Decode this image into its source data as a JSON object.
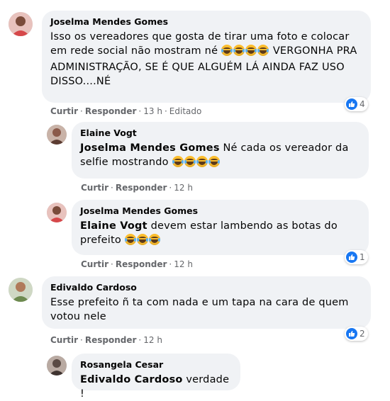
{
  "comments": [
    {
      "author": "Joselma Mendes Gomes",
      "text_before": "Isso os vereadores que gosta de tirar uma foto e colocar em rede social não mostram né",
      "emoji_count": 4,
      "text_after": "VERGONHA PRA ADMINISTRAÇÃO, SE É QUE ALGUÉM LÁ AINDA FAZ USO DISSO....NÉ",
      "like_label": "Curtir",
      "reply_label": "Responder",
      "time": "13 h",
      "edited": "Editado",
      "reaction_count": "4",
      "avatar_color": "#d6484a"
    },
    {
      "author": "Elaine Vogt",
      "mention": "Joselma Mendes Gomes",
      "text_before": "Né cada os vereador da selfie mostrando",
      "emoji_count": 4,
      "like_label": "Curtir",
      "reply_label": "Responder",
      "time": "12 h",
      "avatar_color": "#8a5a4a"
    },
    {
      "author": "Joselma Mendes Gomes",
      "mention": "Elaine Vogt",
      "text_before": "devem estar lambendo as botas do prefeito",
      "emoji_count": 3,
      "like_label": "Curtir",
      "reply_label": "Responder",
      "time": "12 h",
      "reaction_count": "1",
      "avatar_color": "#d6484a"
    },
    {
      "author": "Edivaldo Cardoso",
      "text_before": "Esse prefeito ñ ta com nada e um tapa na cara de quem votou nele",
      "like_label": "Curtir",
      "reply_label": "Responder",
      "time": "12 h",
      "reaction_count": "2",
      "avatar_color": "#6d8a4f"
    },
    {
      "author": "Rosangela Cesar",
      "mention": "Edivaldo Cardoso",
      "text_before": "verdade !",
      "avatar_color": "#5a4a44"
    }
  ],
  "colors": {
    "bubble": "#f0f2f5",
    "meta": "#65676b",
    "like": "#1877f2"
  },
  "icons": {
    "reaction": "like-thumb-icon",
    "emoji": "tears-of-joy-emoji"
  }
}
